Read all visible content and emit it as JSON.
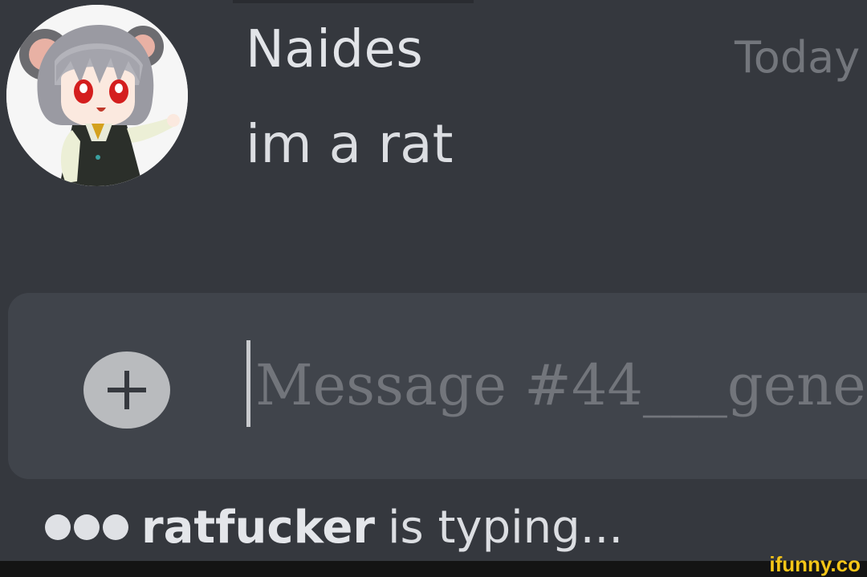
{
  "message": {
    "author": "Naides",
    "timestamp": "Today",
    "text": "im a rat"
  },
  "composer": {
    "placeholder": "Message #44___gene"
  },
  "typing_indicator": {
    "user": "ratfucker",
    "suffix": "is typing..."
  },
  "watermark": "ifunny.co",
  "colors": {
    "background": "#35383e",
    "composer": "#40444b",
    "text_primary": "#dcdee2",
    "text_muted": "#72757b",
    "watermark": "#f5c518"
  }
}
